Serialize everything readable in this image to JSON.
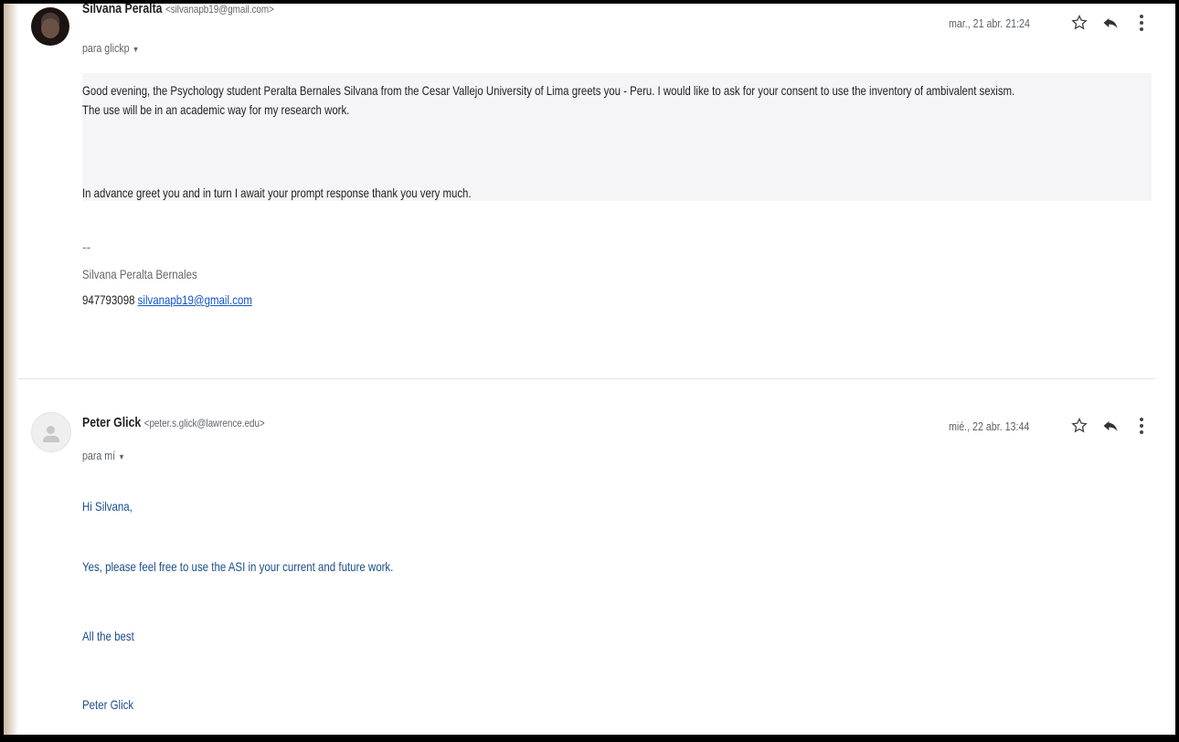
{
  "message1": {
    "sender_name": "Silvana Peralta",
    "sender_email": "<silvanapb19@gmail.com>",
    "to": "para glickp",
    "date": "mar., 21 abr. 21:24",
    "para1_line1": "Good evening, the Psychology student Peralta Bernales Silvana from the Cesar Vallejo University of Lima greets you - Peru. I would like to ask for your consent to use the inventory of ambivalent sexism.",
    "para1_line2": "The use will be in an academic way for my research work.",
    "para2": "In advance greet you and in turn I await your prompt response thank you very much.",
    "sig_dash": "--",
    "sig_name": "Silvana Peralta Bernales",
    "sig_phone": "947793098",
    "sig_email": "silvanapb19@gmail.com"
  },
  "message2": {
    "sender_name": "Peter Glick",
    "sender_email": "<peter.s.glick@lawrence.edu>",
    "to": "para mí",
    "date": "mié., 22 abr. 13:44",
    "lines": [
      "Hi Silvana,",
      "Yes, please feel free to use the ASI in your current and future work.",
      "All the best",
      "Peter Glick"
    ]
  },
  "colors": {
    "link": "#1155cc",
    "reply_text": "#1c4d8e"
  }
}
